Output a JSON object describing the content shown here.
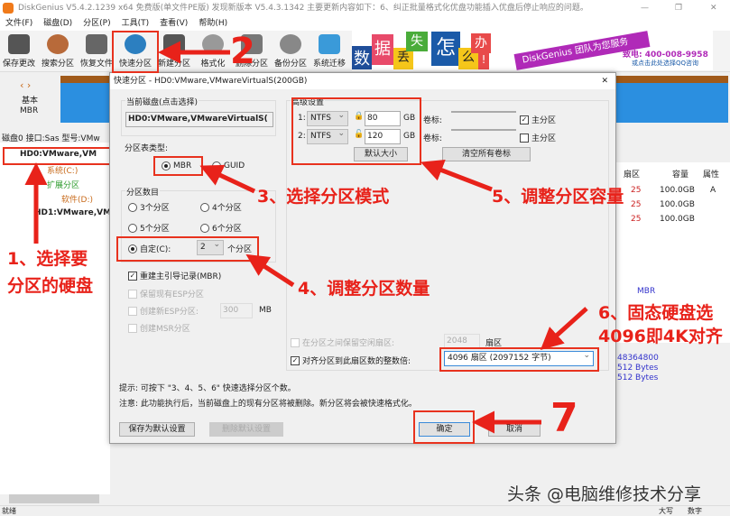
{
  "window": {
    "title": "DiskGenius V5.4.2.1239 x64 免费版(单文件PE版)   发现新版本 V5.4.3.1342   主要更新内容如下：6、纠正批量格式化优盘功能插入优盘后停止响应的问题。",
    "min": "—",
    "max": "❐",
    "close": "✕"
  },
  "menu": [
    "文件(F)",
    "磁盘(D)",
    "分区(P)",
    "工具(T)",
    "查看(V)",
    "帮助(H)"
  ],
  "toolbar": [
    "保存更改",
    "搜索分区",
    "恢复文件",
    "快速分区",
    "新建分区",
    "格式化",
    "删除分区",
    "备份分区",
    "系统迁移"
  ],
  "ad": {
    "chars": [
      "数",
      "据",
      "丢",
      "失",
      "怎",
      "么",
      "办",
      "!"
    ],
    "slogan": "DiskGenius 团队为您服务",
    "phone": "致电: 400-008-9958",
    "qq": "或点击此处选择QQ咨询"
  },
  "left": {
    "nav": "‹ ›",
    "type1": "基本",
    "type2": "MBR",
    "disk_info": "磁盘0 接口:Sas  型号:VMw",
    "tree": [
      {
        "label": "HD0:VMware,VM"
      },
      {
        "label": "系统(C:)"
      },
      {
        "label": "扩展分区"
      },
      {
        "label": "软件(D:)"
      },
      {
        "label": "HD1:VMware,VM"
      }
    ]
  },
  "right": {
    "headers": [
      "扇区",
      "容量",
      "属性"
    ],
    "rows": [
      [
        "25",
        "100.0GB",
        "A"
      ],
      [
        "25",
        "100.0GB",
        ""
      ],
      [
        "25",
        "100.0GB",
        ""
      ]
    ],
    "mbr": "MBR",
    "vals": [
      "48364800",
      "512 Bytes",
      "512 Bytes"
    ]
  },
  "dialog": {
    "title": "快速分区 - HD0:VMware,VMwareVirtualS(200GB)",
    "close": "✕",
    "current_disk_label": "当前磁盘(点击选择)",
    "current_disk": "HD0:VMware,VMwareVirtualS(",
    "table_type_label": "分区表类型:",
    "mbr": "MBR",
    "guid": "GUID",
    "count_label": "分区数目",
    "counts": [
      "3个分区",
      "4个分区",
      "5个分区",
      "6个分区"
    ],
    "custom": "自定(C):",
    "custom_value": "2",
    "custom_unit": "个分区",
    "rebuild_mbr": "重建主引导记录(MBR)",
    "keep_esp": "保留现有ESP分区",
    "new_esp": "创建新ESP分区:",
    "esp_size": "300",
    "esp_unit": "MB",
    "msr": "创建MSR分区",
    "adv_label": "高级设置",
    "parts": [
      {
        "idx": "1:",
        "fs": "NTFS",
        "size": "80",
        "unit": "GB",
        "vol_label": "卷标:",
        "primary": "主分区",
        "primary_checked": true
      },
      {
        "idx": "2:",
        "fs": "NTFS",
        "size": "120",
        "unit": "GB",
        "vol_label": "卷标:",
        "primary": "主分区",
        "primary_checked": false
      }
    ],
    "default_size": "默认大小",
    "clear_labels": "清空所有卷标",
    "reserve_label": "在分区之间保留空闲扇区:",
    "reserve_value": "2048",
    "reserve_unit": "扇区",
    "align_label": "对齐分区到此扇区数的整数倍:",
    "align_value": "4096 扇区 (2097152 字节)",
    "hint1": "提示: 可按下 \"3、4、5、6\" 快速选择分区个数。",
    "hint2": "注意: 此功能执行后，当前磁盘上的现有分区将被删除。新分区将会被快速格式化。",
    "save_default": "保存为默认设置",
    "delete_default": "删除默认设置",
    "ok": "确定",
    "cancel": "取消"
  },
  "annotations": {
    "a1": "1、选择要",
    "a1b": "分区的硬盘",
    "a2": "2",
    "a3": "3、选择分区模式",
    "a4": "4、调整分区数量",
    "a5": "5、调整分区容量",
    "a6": "6、固态硬盘选",
    "a6b": "4096即4K对齐",
    "a7": "7"
  },
  "status": {
    "ready": "就绪",
    "caps": "大写",
    "num": "数字"
  },
  "watermark": "头条 @电脑维修技术分享"
}
